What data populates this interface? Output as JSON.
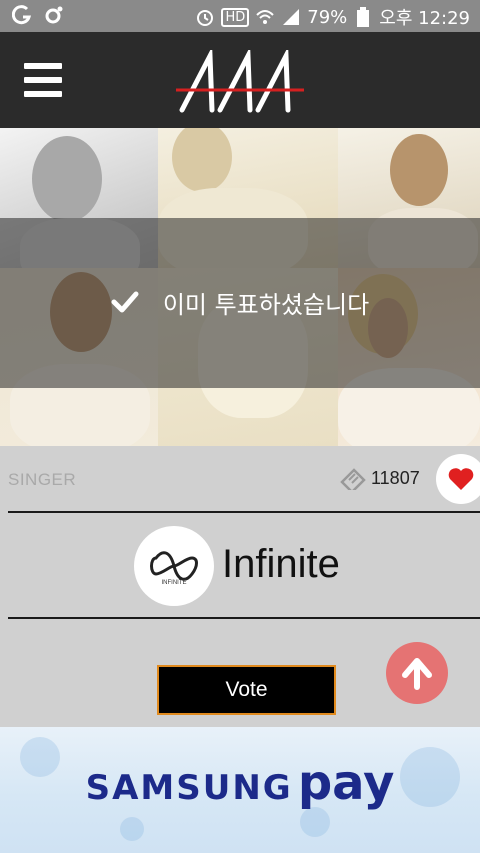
{
  "status_bar": {
    "battery": "79%",
    "time": "오후 12:29",
    "hd_label": "HD"
  },
  "header": {
    "logo_icon": "aaa-logo-icon",
    "menu_icon": "hamburger-menu-icon"
  },
  "hero": {
    "voted_message": "이미 투표하셨습니다"
  },
  "singer": {
    "category_label": "SINGER",
    "vote_count": "11807",
    "artist_name": "Infinite",
    "logo_caption": "INFINITE"
  },
  "actions": {
    "vote_label": "Vote"
  },
  "ad": {
    "brand_part1": "SAMSUNG",
    "brand_part2": "pay"
  },
  "colors": {
    "heart": "#e02020",
    "scroll_top": "#e57373",
    "vote_border": "#e08a1e",
    "ad_text": "#1c2a8a"
  }
}
